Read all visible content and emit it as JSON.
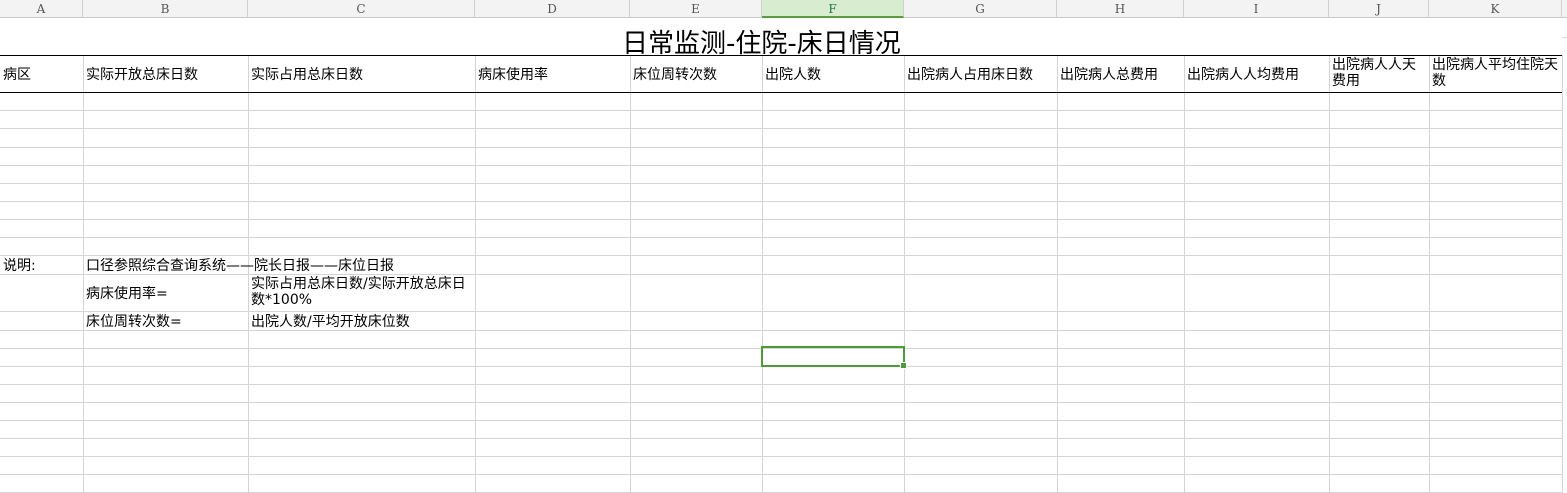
{
  "columns": [
    "A",
    "B",
    "C",
    "D",
    "E",
    "F",
    "G",
    "H",
    "I",
    "J",
    "K"
  ],
  "active_column": "F",
  "title": "日常监测-住院-床日情况",
  "headers": [
    "病区",
    "实际开放总床日数",
    "实际占用总床日数",
    "病床使用率",
    "床位周转次数",
    "出院人数",
    "出院病人占用床日数",
    "出院病人总费用",
    "出院病人人均费用",
    "出院病人人天费用",
    "出院病人平均住院天数"
  ],
  "notes": {
    "label": "说明:",
    "source": "口径参照综合查询系统——院长日报——床位日报",
    "usage_rate_label": "病床使用率=",
    "usage_rate_formula": "实际占用总床日数/实际开放总床日数*100%",
    "turnover_label": "床位周转次数=",
    "turnover_formula": "出院人数/平均开放床位数"
  },
  "colors": {
    "grid": "#d4d4d4",
    "header_bg": "#f3f3f3",
    "active_header_bg": "#d8ecd0",
    "selection": "#4d9a3a"
  }
}
